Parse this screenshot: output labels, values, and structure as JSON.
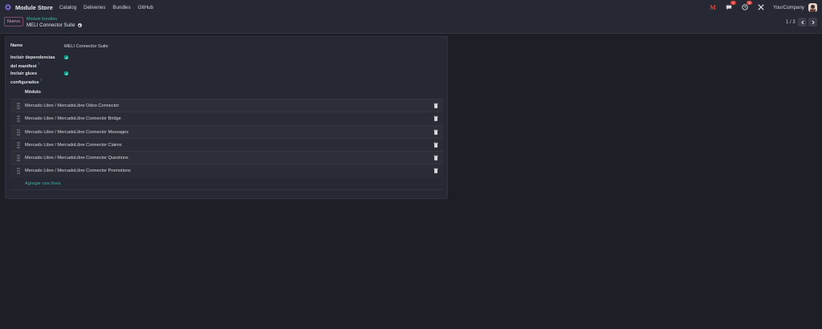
{
  "navbar": {
    "brand": "Module Store",
    "menu": [
      "Catalog",
      "Deliveries",
      "Bundles",
      "GitHub"
    ],
    "mail_letter": "M",
    "chat_badge": "1",
    "activity_badge": "8",
    "company": "YourCompany"
  },
  "control": {
    "new_label": "Nuevo",
    "breadcrumb_parent": "Module bundles",
    "breadcrumb_current": "MELI Connector Suite",
    "pager": "1 / 3"
  },
  "form": {
    "name_label": "Name",
    "name_value": "MELI Connector Suite",
    "deps_label_line1": "Incluir dependencias",
    "deps_label_line2": "del manifest",
    "deps_checked": true,
    "glues_label_line1": "Incluir glues",
    "glues_label_line2": "configurados",
    "glues_checked": true,
    "help_mark": "?",
    "column_header": "Módulo",
    "modules": [
      "Mercado Libre / MercadoLibre Odoo Connector",
      "Mercado Libre / MercadoLibre Connector Bridge",
      "Mercado Libre / MercadoLibre Connector Messages",
      "Mercado Libre / MercadoLibre Connector Claims",
      "Mercado Libre / MercadoLibre Connector Questions",
      "Mercado Libre / MercadoLibre Connector Promotions"
    ],
    "add_line": "Agregar una línea"
  },
  "colors": {
    "accent_teal": "#3fb1a2",
    "checkbox": "#0f9b86",
    "new_button_border": "#7c4d6e",
    "badge": "#d9433a",
    "background": "#1e1f26",
    "panel": "#262833"
  },
  "icons": [
    "app-logo-icon",
    "mail-icon",
    "chat-icon",
    "clock-icon",
    "tools-icon",
    "gear-icon",
    "chevron-left-icon",
    "chevron-right-icon",
    "drag-handle-icon",
    "trash-icon",
    "check-icon"
  ]
}
